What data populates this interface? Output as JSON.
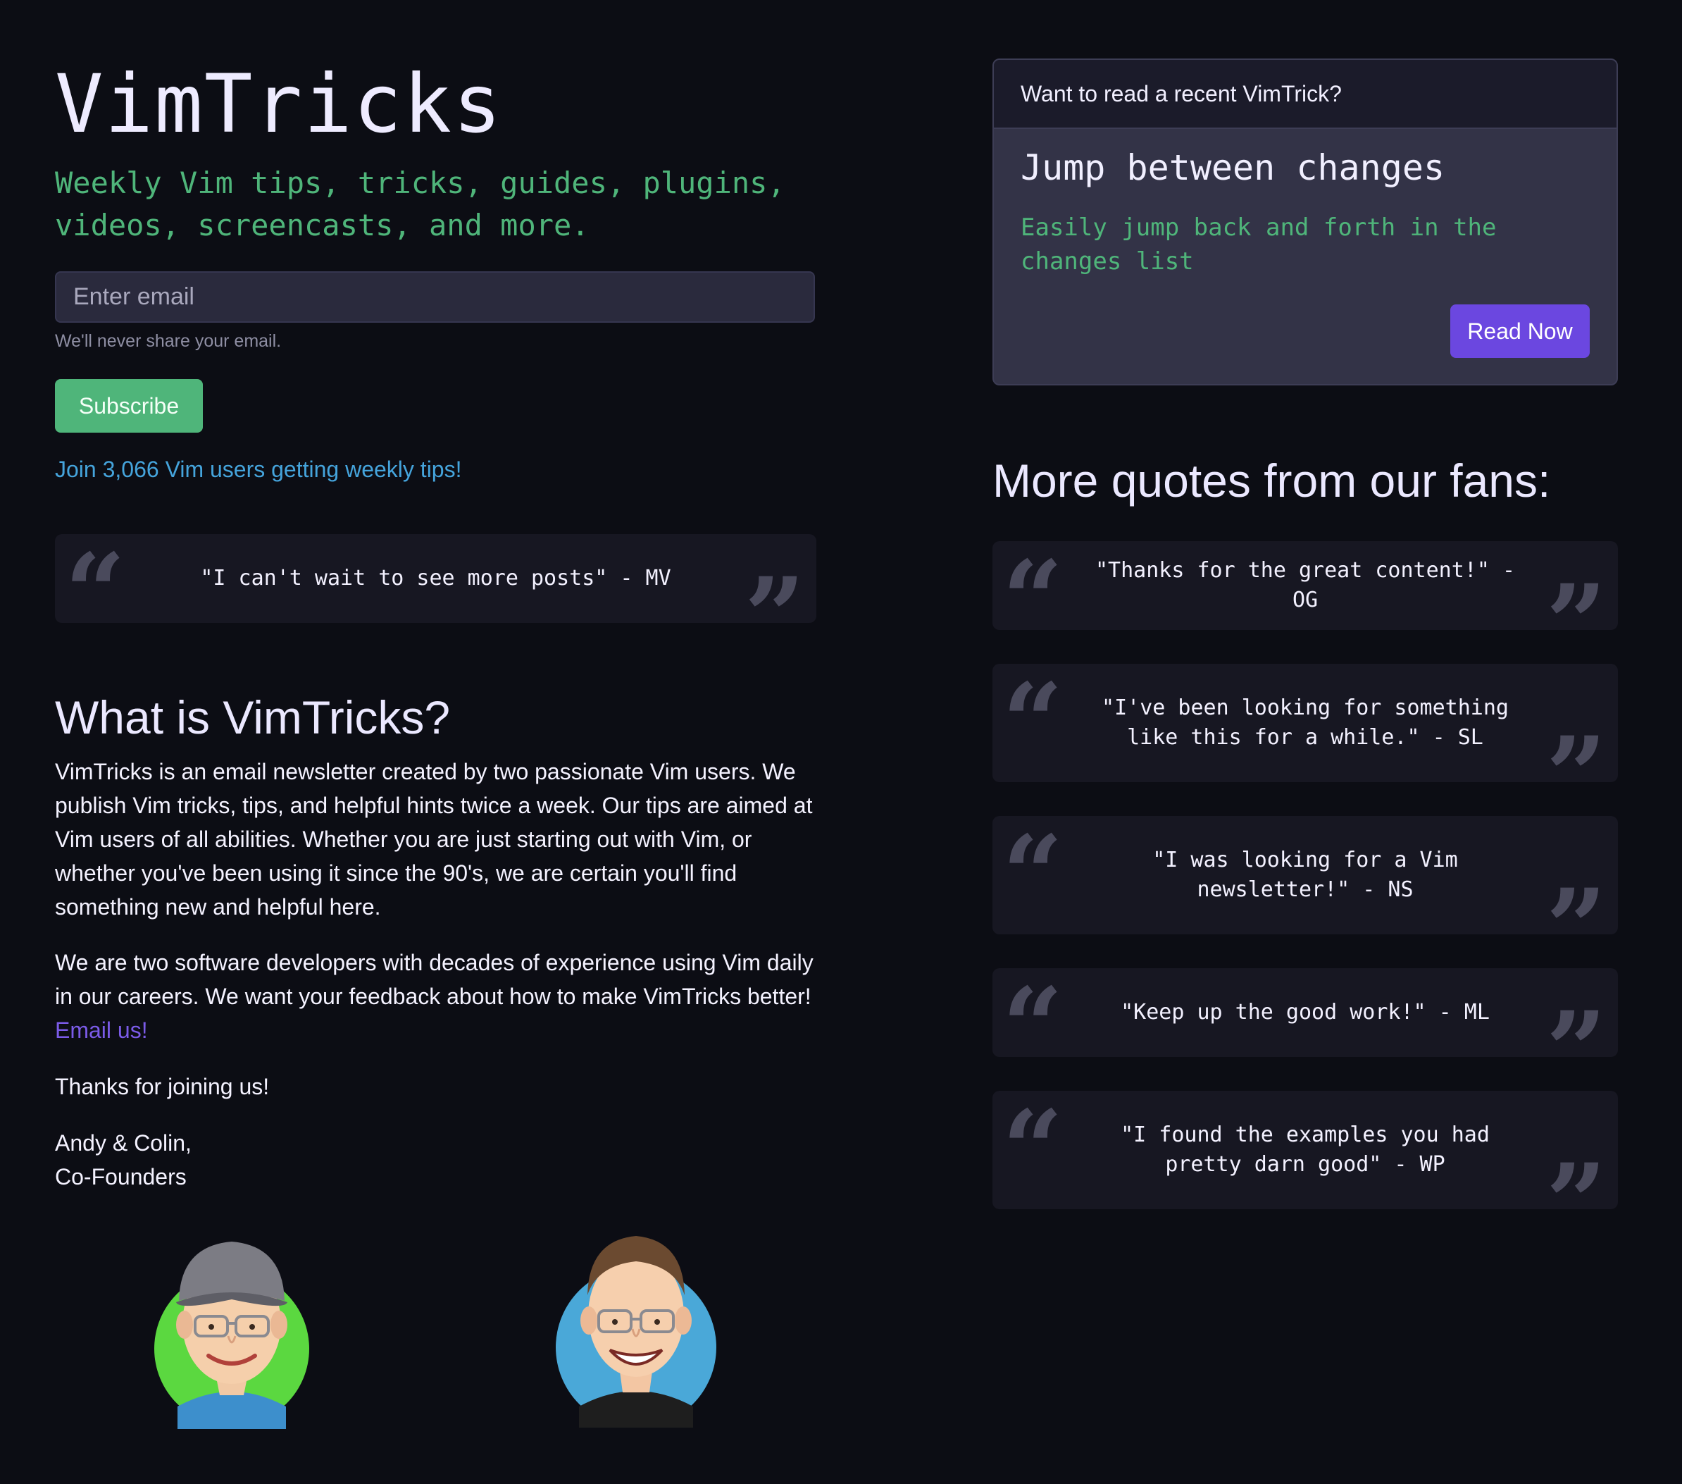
{
  "hero": {
    "title": "VimTricks",
    "tagline": "Weekly Vim tips, tricks, guides, plugins, videos, screencasts, and more."
  },
  "signup": {
    "email_placeholder": "Enter email",
    "email_value": "",
    "help_text": "We'll never share your email.",
    "subscribe_label": "Subscribe",
    "join_text": "Join 3,066 Vim users getting weekly tips!"
  },
  "featured_quote": {
    "text": "\"I can't wait to see more posts\" - MV"
  },
  "about": {
    "heading": "What is VimTricks?",
    "paragraph1": "VimTricks is an email newsletter created by two passionate Vim users. We publish Vim tricks, tips, and helpful hints twice a week. Our tips are aimed at Vim users of all abilities. Whether you are just starting out with Vim, or whether you've been using it since the 90's, we are certain you'll find something new and helpful here.",
    "paragraph2": "We are two software developers with decades of experience using Vim daily in our careers. We want your feedback about how to make VimTricks better!",
    "email_link": "Email us!",
    "thanks": "Thanks for joining us!",
    "signature_names": "Andy & Colin,",
    "signature_role": "Co-Founders"
  },
  "recent": {
    "header": "Want to read a recent VimTrick?",
    "title": "Jump between changes",
    "description": "Easily jump back and forth in the changes list",
    "button_label": "Read Now"
  },
  "fan_quotes": {
    "heading": "More quotes from our fans:",
    "items": [
      {
        "text": "\"Thanks for the great content!\" - OG"
      },
      {
        "text": "\"I've been looking for something like this for a while.\" - SL"
      },
      {
        "text": "\"I was looking for a Vim newsletter!\" - NS"
      },
      {
        "text": "\"Keep up the good work!\" - ML"
      },
      {
        "text": "\"I found the examples you had pretty darn good\" - WP"
      }
    ]
  },
  "colors": {
    "background": "#0c0d14",
    "accent_green": "#4fb57a",
    "accent_blue": "#45a4dc",
    "accent_purple": "#6b47e0",
    "card": "#171722"
  },
  "icons": {
    "quote_open": "left-double-quote-icon",
    "quote_close": "right-double-quote-icon",
    "avatars": [
      "andy-avatar",
      "colin-avatar"
    ]
  }
}
